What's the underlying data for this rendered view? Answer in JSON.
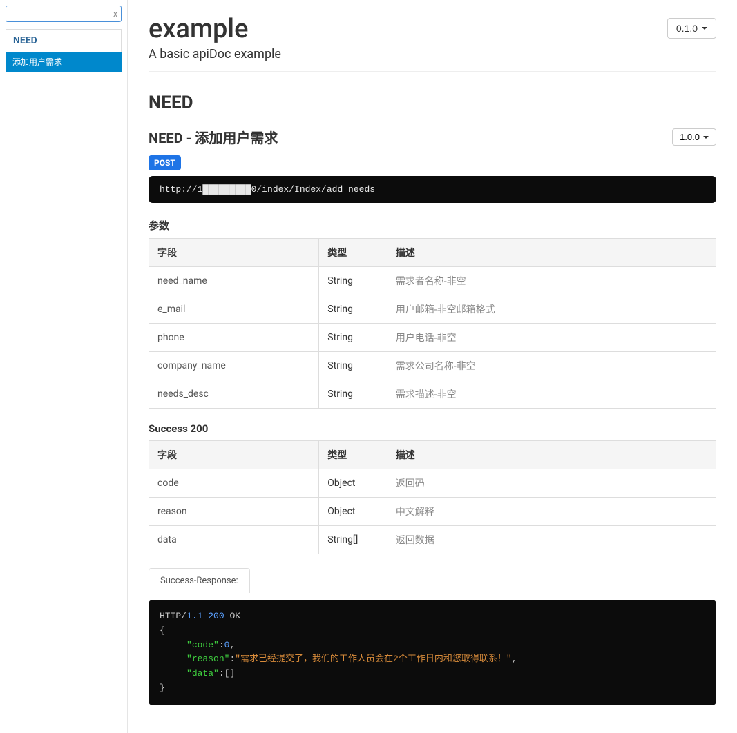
{
  "sidebar": {
    "search_value": "",
    "clear_label": "x",
    "section_label": "NEED",
    "active_item_label": "添加用户需求"
  },
  "header": {
    "title": "example",
    "description": "A basic apiDoc example",
    "version": "0.1.0"
  },
  "group": {
    "heading": "NEED"
  },
  "endpoint": {
    "title": "NEED - 添加用户需求",
    "version": "1.0.0",
    "method": "POST",
    "url": "http://1█████████0/index/Index/add_needs"
  },
  "params": {
    "label": "参数",
    "headers": {
      "field": "字段",
      "type": "类型",
      "desc": "描述"
    },
    "rows": [
      {
        "field": "need_name",
        "type": "String",
        "desc": "需求者名称-非空"
      },
      {
        "field": "e_mail",
        "type": "String",
        "desc": "用户邮箱-非空邮箱格式"
      },
      {
        "field": "phone",
        "type": "String",
        "desc": "用户电话-非空"
      },
      {
        "field": "company_name",
        "type": "String",
        "desc": "需求公司名称-非空"
      },
      {
        "field": "needs_desc",
        "type": "String",
        "desc": "需求描述-非空"
      }
    ]
  },
  "success": {
    "label": "Success 200",
    "headers": {
      "field": "字段",
      "type": "类型",
      "desc": "描述"
    },
    "rows": [
      {
        "field": "code",
        "type": "Object",
        "desc": "返回码"
      },
      {
        "field": "reason",
        "type": "Object",
        "desc": "中文解释"
      },
      {
        "field": "data",
        "type": "String[]",
        "desc": "返回数据"
      }
    ]
  },
  "response": {
    "tab_label": "Success-Response:",
    "http_proto": "HTTP/",
    "http_ver": "1.1",
    "http_status": "200",
    "http_ok": "OK",
    "body": {
      "code_key": "\"code\"",
      "code_val": "0",
      "reason_key": "\"reason\"",
      "reason_val": "\"需求已经提交了，我们的工作人员会在2个工作日内和您取得联系！\"",
      "data_key": "\"data\"",
      "data_val": "[]"
    }
  }
}
